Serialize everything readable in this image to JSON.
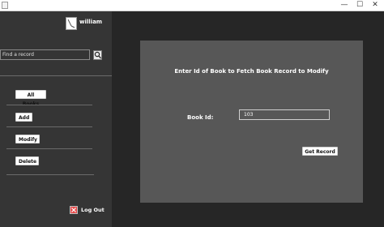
{
  "titlebar": {
    "minimize_glyph": "—",
    "maximize_glyph": "☐",
    "close_glyph": "✕"
  },
  "sidebar": {
    "user": {
      "name": "william",
      "icon": "user-avatar-icon"
    },
    "search": {
      "placeholder": "Find a record",
      "value": "",
      "icon": "search-icon"
    },
    "buttons": {
      "all_books": "All Books",
      "add": "Add",
      "modify": "Modify",
      "delete": "Delete"
    },
    "logout": {
      "label": "Log Out",
      "icon": "logout-icon",
      "icon_color": "#e64a4a"
    }
  },
  "panel": {
    "heading": "Enter Id of Book to Fetch Book Record to Modify",
    "book_id_label": "Book Id:",
    "book_id_value": "103",
    "submit_label": "Get Record"
  },
  "colors": {
    "sidebar_bg": "#353535",
    "main_bg": "#262626",
    "panel_bg": "#575757",
    "button_bg": "#ffffff"
  }
}
